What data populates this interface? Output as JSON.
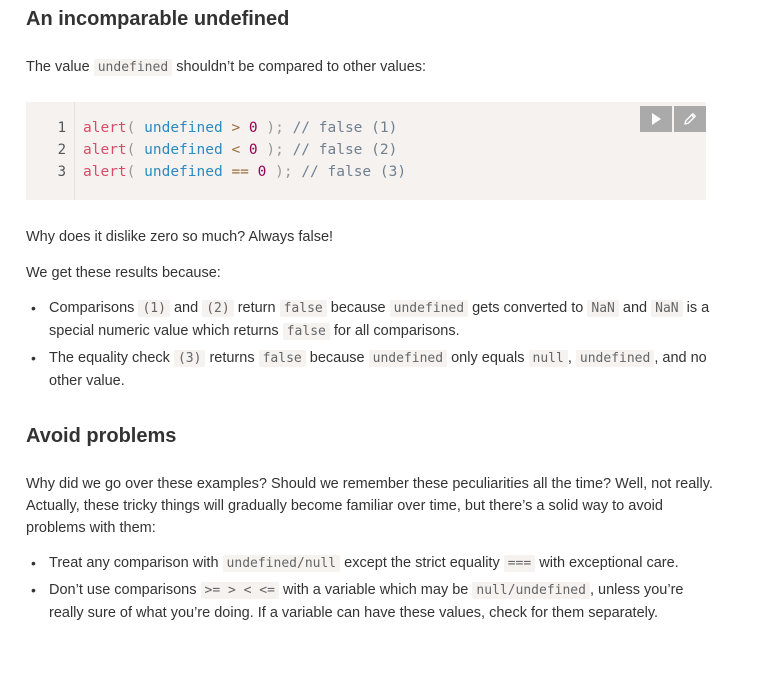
{
  "section1": {
    "title": "An incomparable undefined",
    "intro_before": "The value ",
    "intro_code": "undefined",
    "intro_after": " shouldn’t be compared to other values:"
  },
  "code_example": {
    "lines": [
      {
        "num": "1",
        "fn": "alert",
        "open": "(",
        "kw": "undefined",
        "op": ">",
        "val": "0",
        "close": ");",
        "comment": "// false (1)"
      },
      {
        "num": "2",
        "fn": "alert",
        "open": "(",
        "kw": "undefined",
        "op": "<",
        "val": "0",
        "close": ");",
        "comment": "// false (2)"
      },
      {
        "num": "3",
        "fn": "alert",
        "open": "(",
        "kw": "undefined",
        "op": "==",
        "val": "0",
        "close": ");",
        "comment": "// false (3)"
      }
    ],
    "toolbar": [
      "run-icon",
      "edit-icon"
    ]
  },
  "section1_text": {
    "question": "Why does it dislike zero so much? Always false!",
    "because": "We get these results because:"
  },
  "bullets1": {
    "b1": {
      "t1": "Comparisons ",
      "c1": "(1)",
      "t2": " and ",
      "c2": "(2)",
      "t3": " return ",
      "c3": "false",
      "t4": " because ",
      "c4": "undefined",
      "t5": " gets converted to ",
      "c5": "NaN",
      "t6": " and ",
      "c6": "NaN",
      "t7": " is a special numeric value which returns ",
      "c7": "false",
      "t8": " for all comparisons."
    },
    "b2": {
      "t1": "The equality check ",
      "c1": "(3)",
      "t2": " returns ",
      "c2": "false",
      "t3": " because ",
      "c3": "undefined",
      "t4": " only equals ",
      "c4": "null",
      "t5": ", ",
      "c5": "undefined",
      "t6": ", and no other value."
    }
  },
  "section2": {
    "title": "Avoid problems",
    "intro": "Why did we go over these examples? Should we remember these peculiarities all the time? Well, not really. Actually, these tricky things will gradually become familiar over time, but there’s a solid way to avoid problems with them:"
  },
  "bullets2": {
    "b1": {
      "t1": "Treat any comparison with ",
      "c1": "undefined/null",
      "t2": " except the strict equality ",
      "c2": "===",
      "t3": " with exceptional care."
    },
    "b2": {
      "t1": "Don’t use comparisons ",
      "c1": ">= > < <=",
      "t2": " with a variable which may be ",
      "c2": "null/undefined",
      "t3": ", unless you’re really sure of what you’re doing. If a variable can have these values, check for them separately."
    }
  },
  "colors": {
    "code_background": "#f5f2f0",
    "function": "#dd4a68",
    "keyword": "#2c8ac0",
    "comment": "#708090",
    "toolbar_button": "#aaaaaa"
  }
}
